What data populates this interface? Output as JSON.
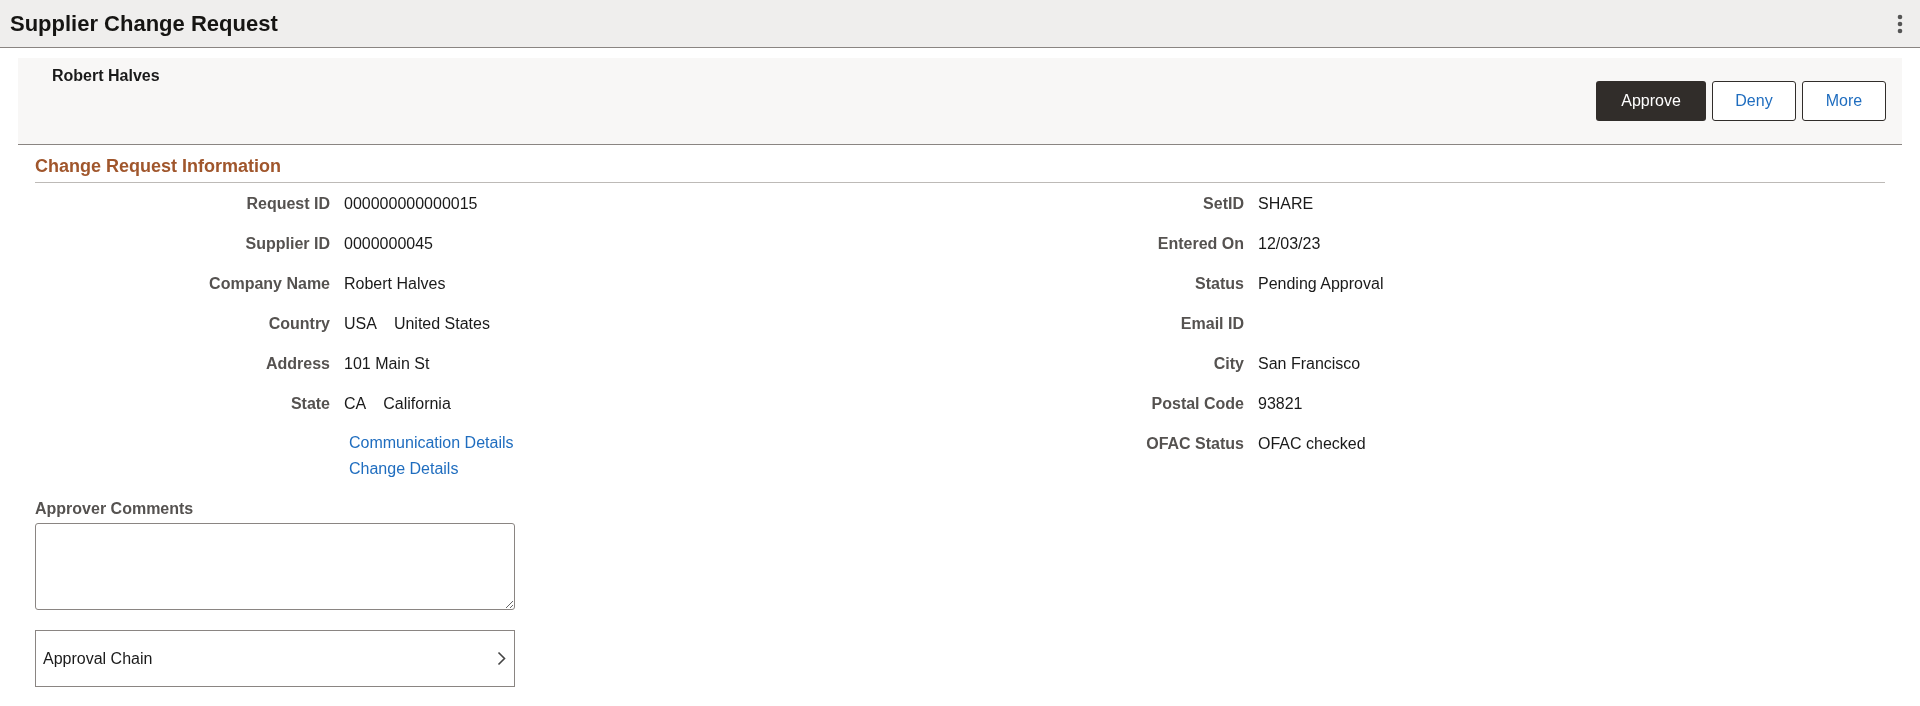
{
  "header": {
    "title": "Supplier Change Request"
  },
  "banner": {
    "name": "Robert Halves",
    "buttons": [
      {
        "label": "Approve",
        "kind": "primary"
      },
      {
        "label": "Deny",
        "kind": "secondary"
      },
      {
        "label": "More",
        "kind": "secondary"
      }
    ]
  },
  "section": {
    "title": "Change Request Information",
    "left_fields": [
      {
        "label": "Request ID",
        "values": [
          "000000000000015"
        ]
      },
      {
        "label": "Supplier ID",
        "values": [
          "0000000045"
        ]
      },
      {
        "label": "Company Name",
        "values": [
          "Robert Halves"
        ]
      },
      {
        "label": "Country",
        "values": [
          "USA",
          "United States"
        ]
      },
      {
        "label": "Address",
        "values": [
          "101 Main St"
        ]
      },
      {
        "label": "State",
        "values": [
          "CA",
          "California"
        ]
      }
    ],
    "links": [
      "Communication Details",
      "Change Details"
    ],
    "right_fields": [
      {
        "label": "SetID",
        "values": [
          "SHARE"
        ]
      },
      {
        "label": "Entered On",
        "values": [
          "12/03/23"
        ]
      },
      {
        "label": "Status",
        "values": [
          "Pending Approval"
        ]
      },
      {
        "label": "Email ID"
      },
      {
        "label": "City",
        "values": [
          "San Francisco"
        ]
      },
      {
        "label": "Postal Code",
        "values": [
          "93821"
        ]
      },
      {
        "label": "OFAC Status",
        "values": [
          "OFAC checked"
        ]
      }
    ]
  },
  "comments": {
    "label": "Approver Comments"
  },
  "approval_chain": {
    "label": "Approval Chain"
  }
}
